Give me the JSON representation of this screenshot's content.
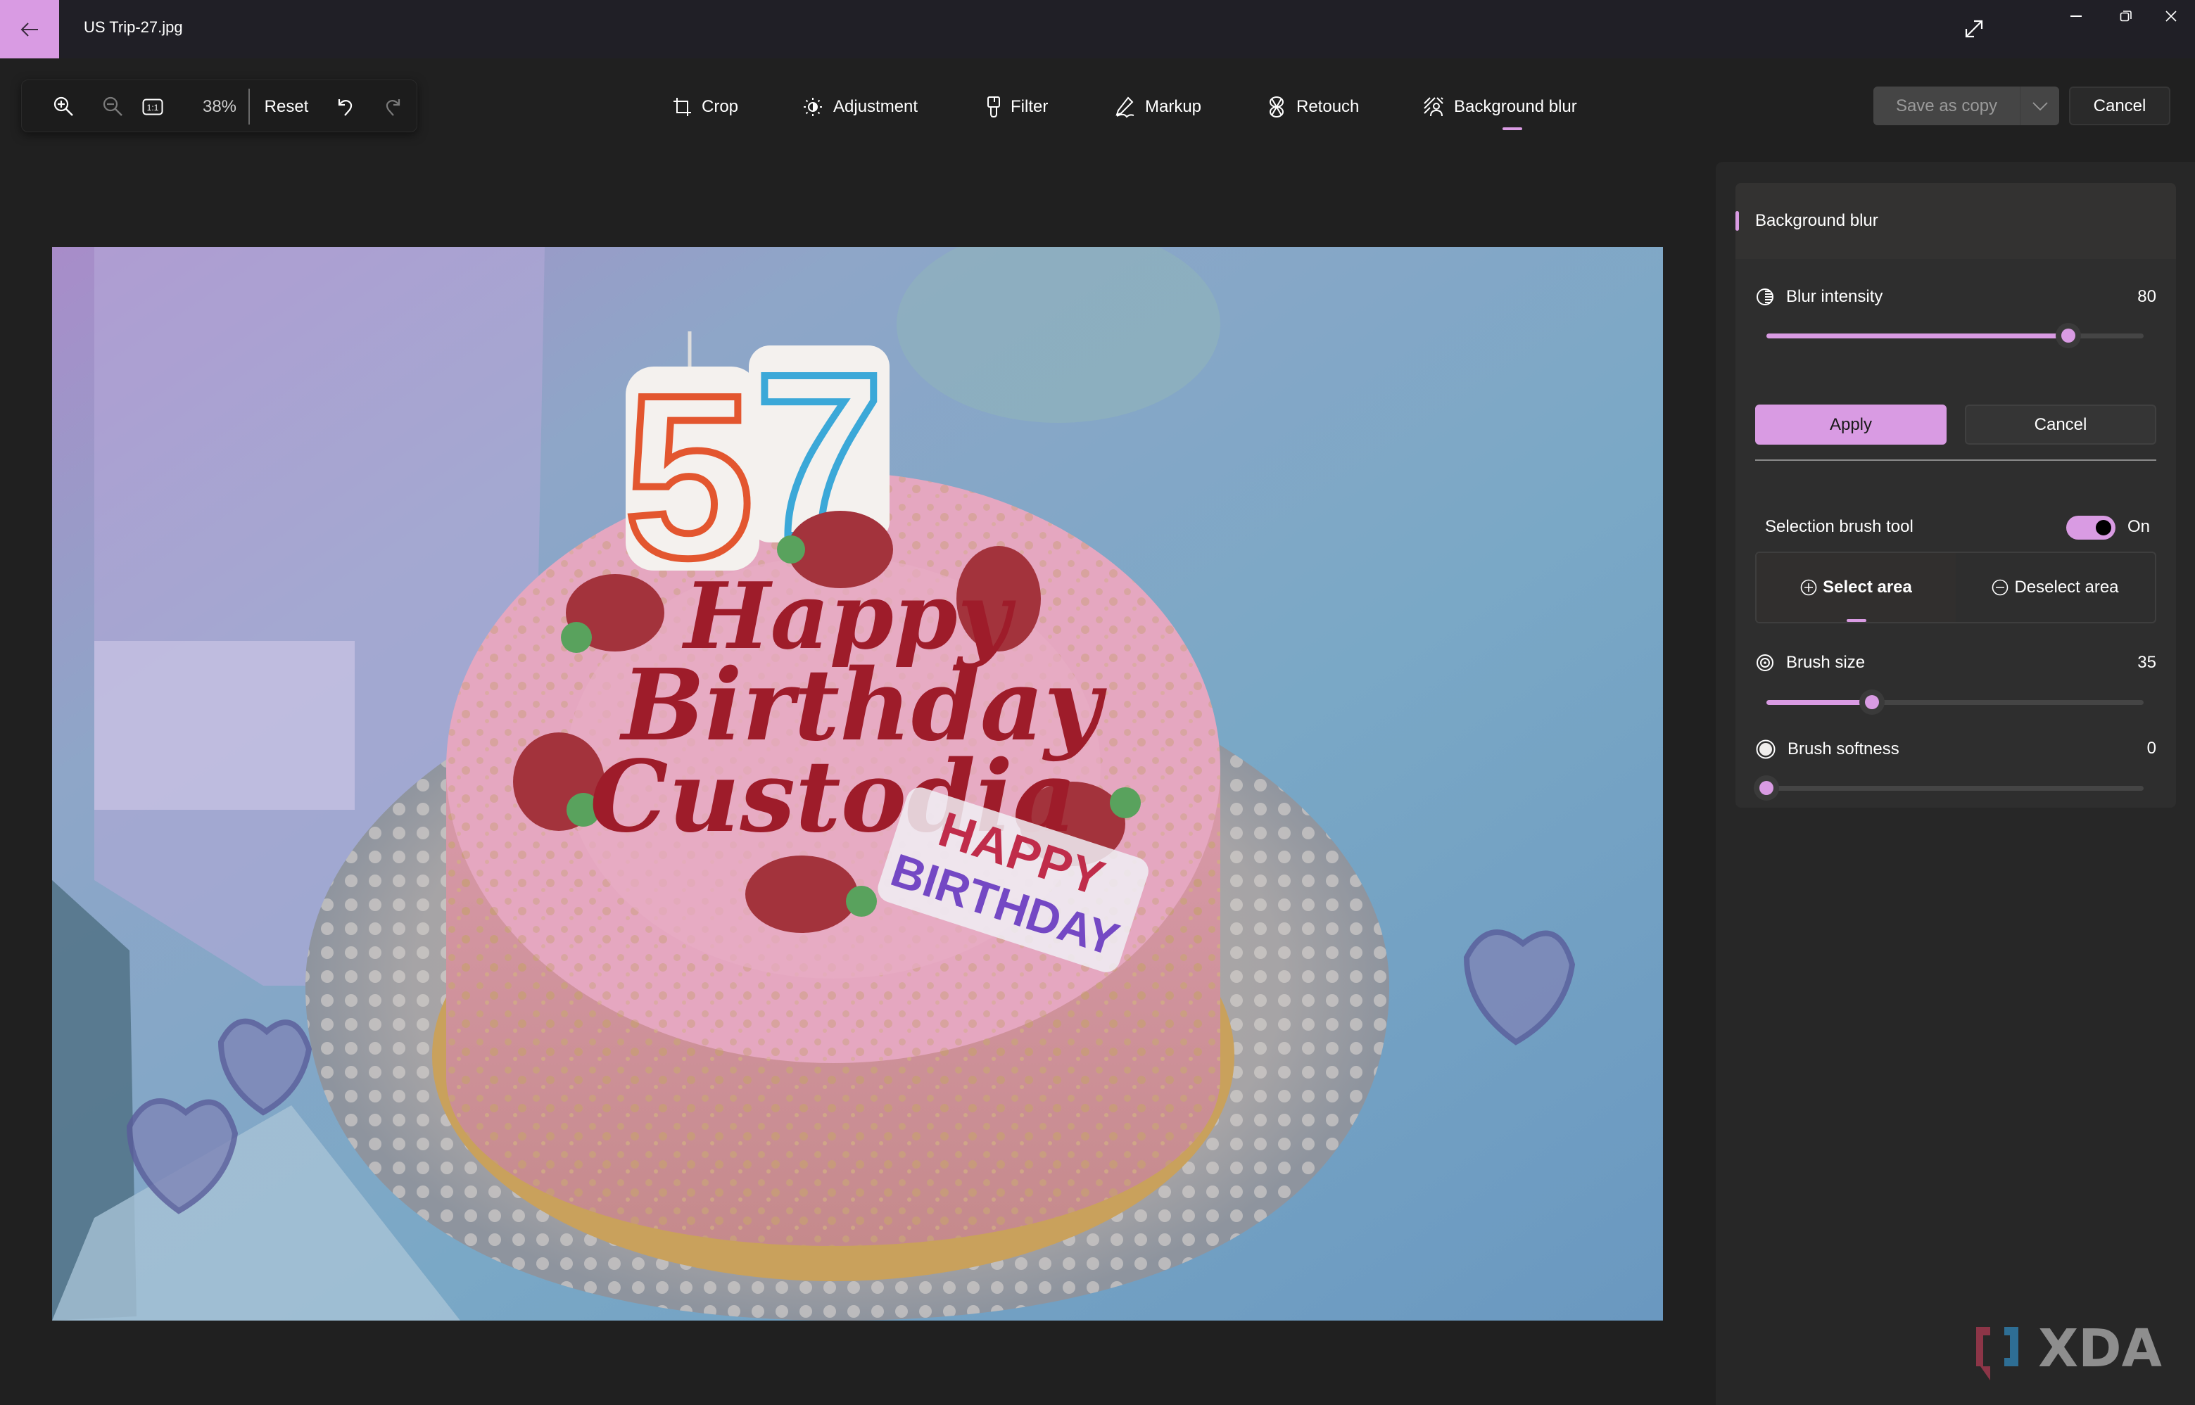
{
  "window": {
    "title": "US Trip-27.jpg",
    "accent_color": "#d99be3"
  },
  "titlebar": {
    "back_icon": "arrow-left-icon",
    "expand_icon": "expand-diagonal-icon",
    "window_controls": [
      "minimize-icon",
      "restore-icon",
      "close-icon"
    ]
  },
  "zoom_toolbar": {
    "zoom_in_icon": "zoom-in-icon",
    "zoom_out_icon": "zoom-out-icon",
    "actual_size_label": "1:1",
    "zoom_level": "38%",
    "reset_label": "Reset",
    "undo_icon": "undo-icon",
    "redo_icon": "redo-icon"
  },
  "tools": [
    {
      "label": "Crop",
      "icon": "crop-icon"
    },
    {
      "label": "Adjustment",
      "icon": "brightness-icon"
    },
    {
      "label": "Filter",
      "icon": "filter-brush-icon"
    },
    {
      "label": "Markup",
      "icon": "pen-icon"
    },
    {
      "label": "Retouch",
      "icon": "retouch-icon"
    },
    {
      "label": "Background blur",
      "icon": "background-blur-icon",
      "active": true
    }
  ],
  "actions": {
    "save_label": "Save as copy",
    "cancel_label": "Cancel"
  },
  "panel": {
    "header": "Background blur",
    "blur_intensity": {
      "label": "Blur intensity",
      "value": "80",
      "fraction": 0.8
    },
    "apply_label": "Apply",
    "cancel_label": "Cancel",
    "selection_brush": {
      "label": "Selection brush tool",
      "state_label": "On",
      "enabled": true
    },
    "segments": [
      {
        "label": "Select area",
        "icon": "plus-circle-icon",
        "active": true
      },
      {
        "label": "Deselect area",
        "icon": "minus-circle-icon",
        "active": false
      }
    ],
    "brush_size": {
      "label": "Brush size",
      "value": "35",
      "fraction": 0.28
    },
    "brush_softness": {
      "label": "Brush softness",
      "value": "0",
      "fraction": 0.0
    }
  },
  "photo": {
    "description": "Pink birthday cake with 57 candles on glass plate",
    "cake_text": [
      "Happy",
      "Birthday",
      "Custodia"
    ],
    "topper_text": [
      "HAPPY",
      "BIRTHDAY"
    ],
    "candle_text": "57"
  },
  "watermark": {
    "text": "XDA"
  }
}
